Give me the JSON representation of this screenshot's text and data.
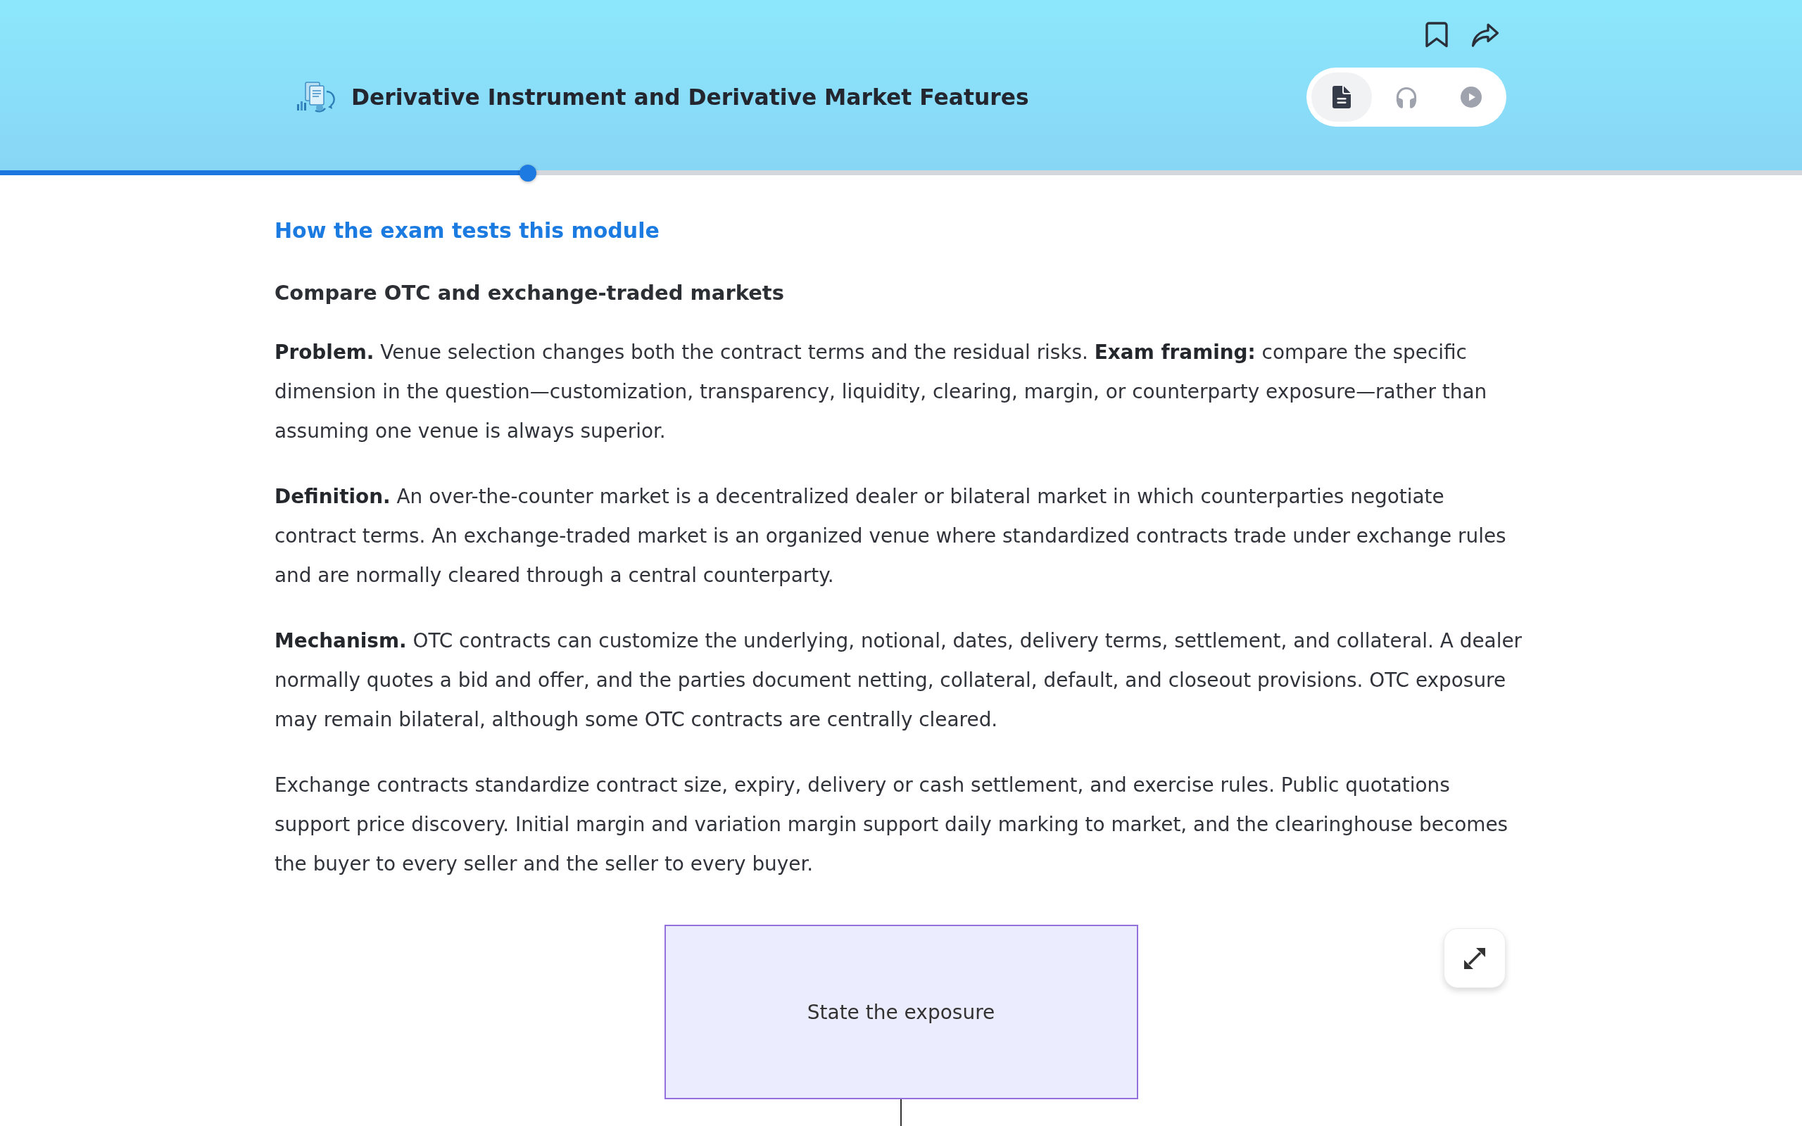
{
  "header": {
    "title": "Derivative Instrument and Derivative Market Features",
    "modes": [
      {
        "kind": "text",
        "selected": true
      },
      {
        "kind": "audio",
        "selected": false
      },
      {
        "kind": "video",
        "selected": false
      }
    ]
  },
  "progress": {
    "level": 0.293
  },
  "article": {
    "section_link": "How the exam tests this module",
    "heading": "Compare OTC and exchange-traded markets",
    "paragraphs": [
      "**Problem.** Venue selection changes both the contract terms and the residual risks. **Exam framing:** compare the specific dimension in the question—customization, transparency, liquidity, clearing, margin, or counterparty exposure—rather than assuming one venue is always superior.",
      "**Definition.** An over-the-counter market is a decentralized dealer or bilateral market in which counterparties negotiate contract terms. An exchange-traded market is an organized venue where standardized contracts trade under exchange rules and are normally cleared through a central counterparty.",
      "**Mechanism.** OTC contracts can customize the underlying, notional, dates, delivery terms, settlement, and collateral. A dealer normally quotes a bid and offer, and the parties document netting, collateral, default, and closeout provisions. OTC exposure may remain bilateral, although some OTC contracts are centrally cleared.",
      "Exchange contracts standardize contract size, expiry, delivery or cash settlement, and exercise rules. Public quotations support price discovery. Initial margin and variation margin support daily marking to market, and the clearinghouse becomes the buyer to every seller and the seller to every buyer."
    ],
    "diagram": {
      "nodes": [
        {
          "label": "State the exposure"
        }
      ]
    }
  }
}
